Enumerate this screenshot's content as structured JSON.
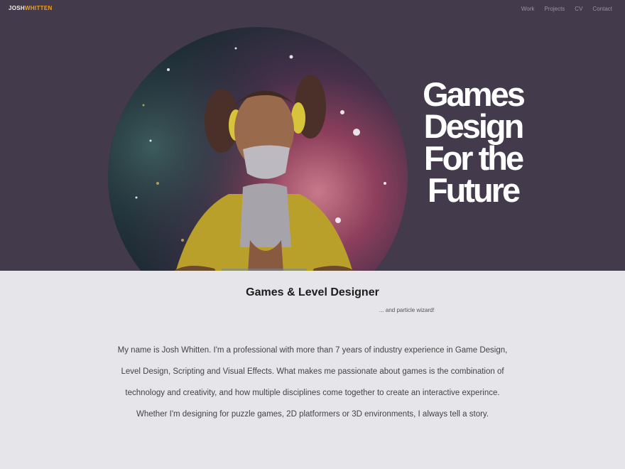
{
  "header": {
    "logo_part1": "JOSH",
    "logo_part2": "WHITTEN",
    "nav": [
      "Work",
      "Projects",
      "CV",
      "Contact"
    ]
  },
  "hero": {
    "headline": [
      "Games",
      "Design",
      "For the",
      "Future"
    ],
    "background_color": "#433a4c"
  },
  "intro": {
    "role": "Games & Level Designer",
    "tagline": "... and particle wizard!",
    "bio": "My name is Josh Whitten. I'm a professional with more than 7 years of industry experience in Game Design, Level Design, Scripting and Visual Effects. What makes me passionate about games is the combination of technology and creativity, and how multiple disciplines come together to create an interactive experince. Whether I'm designing for puzzle games, 2D platformers or 3D environments, I always tell a story."
  }
}
